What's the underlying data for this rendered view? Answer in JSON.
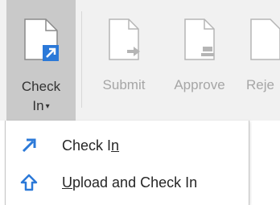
{
  "ribbon": {
    "check_in": {
      "line1": "Check",
      "line2": "In",
      "caret": "▾"
    },
    "submit": "Submit",
    "approve": "Approve",
    "reject_partial": "Reje"
  },
  "menu": {
    "items": [
      {
        "label_prefix": "Check I",
        "label_accel": "n",
        "label_suffix": "",
        "icon": "check-in-arrow-icon"
      },
      {
        "label_prefix": "",
        "label_accel": "U",
        "label_suffix": "pload and Check In",
        "icon": "upload-arrow-icon"
      }
    ]
  },
  "colors": {
    "ribbon_bg": "#f1f1f1",
    "selected_bg": "#c9c9c9",
    "accent_blue": "#2b79d8",
    "disabled_text": "#a6a6a6"
  }
}
